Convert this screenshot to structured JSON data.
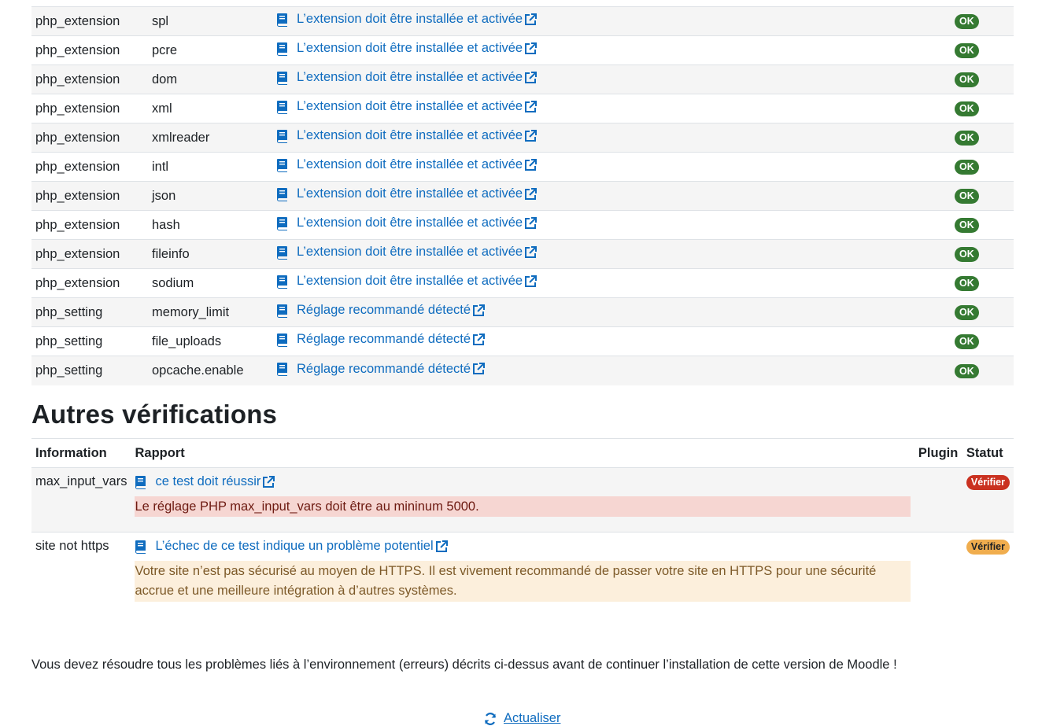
{
  "env_rows": [
    {
      "type": "php_extension",
      "name": "spl",
      "report": "L’extension doit être installée et activée",
      "status": "OK"
    },
    {
      "type": "php_extension",
      "name": "pcre",
      "report": "L’extension doit être installée et activée",
      "status": "OK"
    },
    {
      "type": "php_extension",
      "name": "dom",
      "report": "L’extension doit être installée et activée",
      "status": "OK"
    },
    {
      "type": "php_extension",
      "name": "xml",
      "report": "L’extension doit être installée et activée",
      "status": "OK"
    },
    {
      "type": "php_extension",
      "name": "xmlreader",
      "report": "L’extension doit être installée et activée",
      "status": "OK"
    },
    {
      "type": "php_extension",
      "name": "intl",
      "report": "L’extension doit être installée et activée",
      "status": "OK"
    },
    {
      "type": "php_extension",
      "name": "json",
      "report": "L’extension doit être installée et activée",
      "status": "OK"
    },
    {
      "type": "php_extension",
      "name": "hash",
      "report": "L’extension doit être installée et activée",
      "status": "OK"
    },
    {
      "type": "php_extension",
      "name": "fileinfo",
      "report": "L’extension doit être installée et activée",
      "status": "OK"
    },
    {
      "type": "php_extension",
      "name": "sodium",
      "report": "L’extension doit être installée et activée",
      "status": "OK"
    },
    {
      "type": "php_setting",
      "name": "memory_limit",
      "report": "Réglage recommandé détecté",
      "status": "OK"
    },
    {
      "type": "php_setting",
      "name": "file_uploads",
      "report": "Réglage recommandé détecté",
      "status": "OK"
    },
    {
      "type": "php_setting",
      "name": "opcache.enable",
      "report": "Réglage recommandé détecté",
      "status": "OK"
    }
  ],
  "other_checks": {
    "heading": "Autres vérifications",
    "headers": {
      "info": "Information",
      "report": "Rapport",
      "plugin": "Plugin",
      "status": "Statut"
    },
    "rows": [
      {
        "info": "max_input_vars",
        "link": "ce test doit réussir",
        "message": "Le réglage PHP max_input_vars doit être au mininum 5000.",
        "status": "Vérifier",
        "level": "error"
      },
      {
        "info": "site not https",
        "link": "L’échec de ce test indique un problème potentiel",
        "message": "Votre site n’est pas sécurisé au moyen de HTTPS. Il est vivement recommandé de passer votre site en HTTPS pour une sécurité accrue et une meilleure intégration à d’autres systèmes.",
        "status": "Vérifier",
        "level": "warning"
      }
    ]
  },
  "footnote": "Vous devez résoudre tous les problèmes liés à l’environnement (erreurs) décrits ci-dessus avant de continuer l’installation de cette version de Moodle !",
  "refresh_label": "Actualiser",
  "colors": {
    "link": "#0f6cbf",
    "ok": "#357a32",
    "error": "#ca3120",
    "warning": "#f0ad4e"
  },
  "icons": {
    "doc": "book-icon",
    "external": "external-link-icon",
    "refresh": "refresh-icon"
  }
}
